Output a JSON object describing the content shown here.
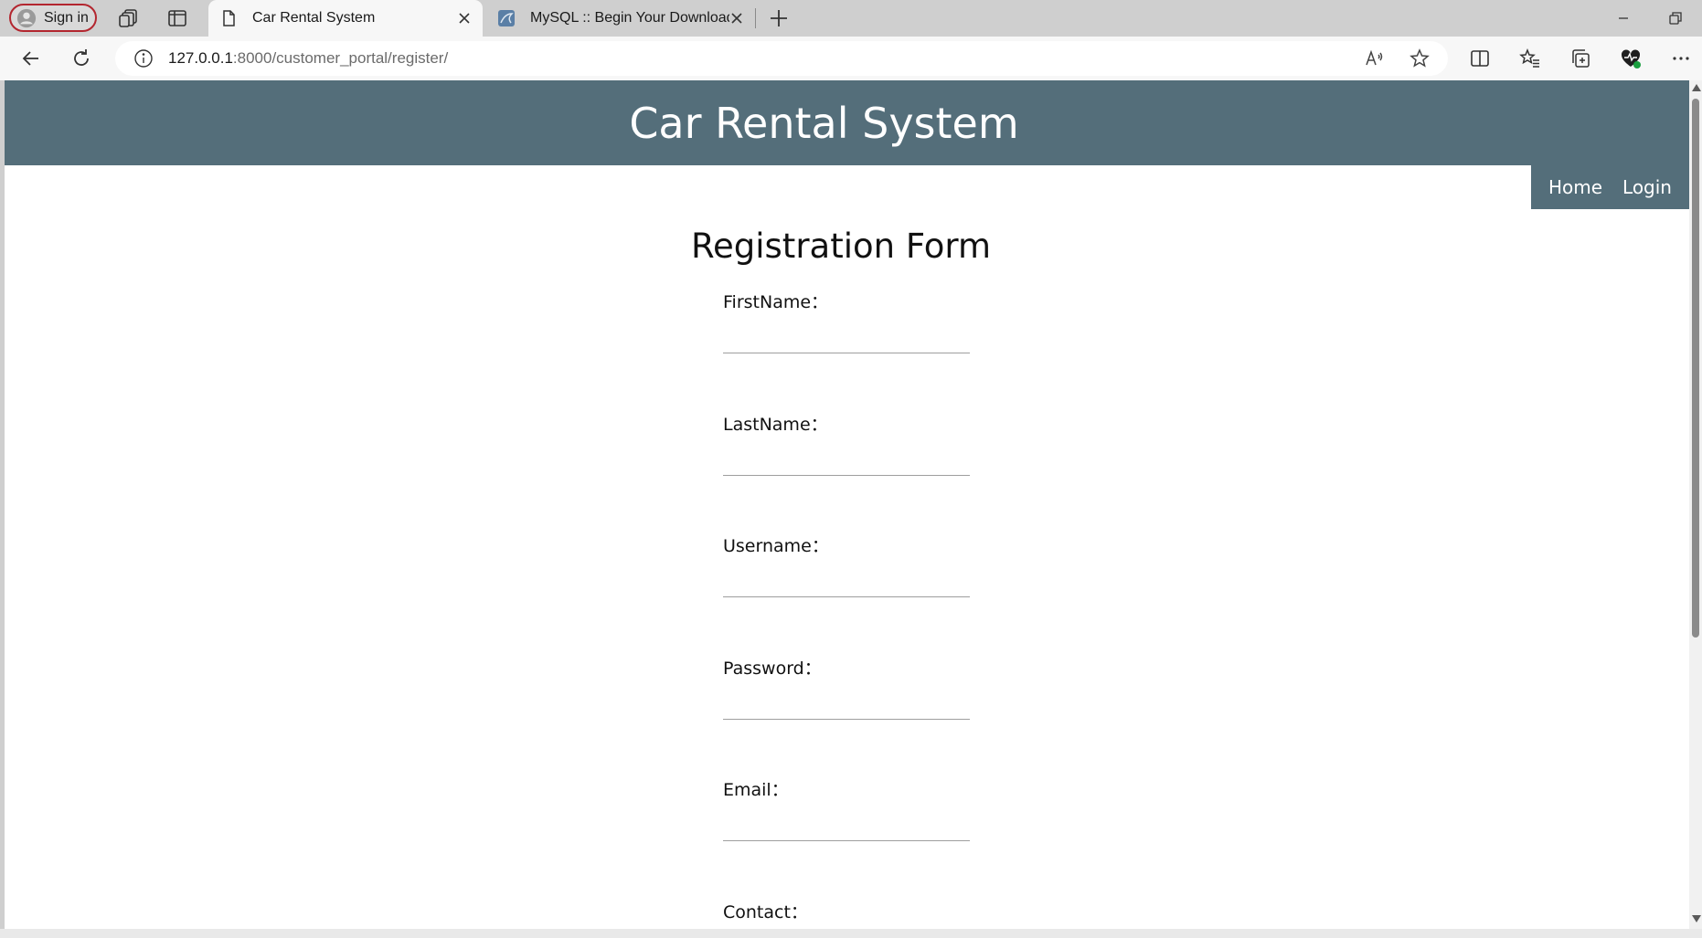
{
  "browser": {
    "signin_label": "Sign in",
    "tabs": [
      {
        "title": "Car Rental System",
        "active": true
      },
      {
        "title": "MySQL :: Begin Your Download",
        "active": false
      }
    ],
    "url_host": "127.0.0.1",
    "url_rest": ":8000/customer_portal/register/"
  },
  "site": {
    "title": "Car Rental System",
    "nav": [
      {
        "label": "Home"
      },
      {
        "label": "Login"
      }
    ],
    "header_color": "#546e7a"
  },
  "form": {
    "title": "Registration Form",
    "fields": [
      {
        "label": "FirstName：",
        "value": ""
      },
      {
        "label": "LastName：",
        "value": ""
      },
      {
        "label": "Username：",
        "value": ""
      },
      {
        "label": "Password：",
        "value": ""
      },
      {
        "label": "Email：",
        "value": ""
      },
      {
        "label": "Contact：",
        "value": ""
      }
    ]
  }
}
